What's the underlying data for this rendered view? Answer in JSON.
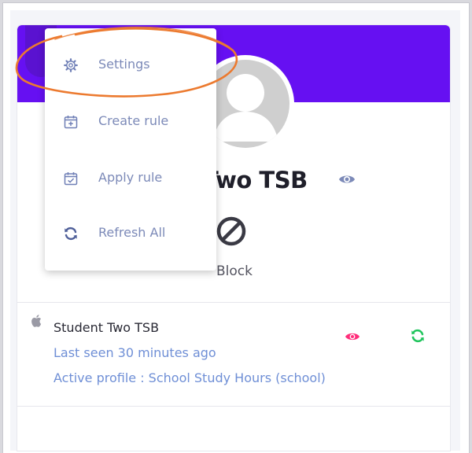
{
  "menu": {
    "items": [
      {
        "label": "Settings",
        "icon": "gear-icon"
      },
      {
        "label": "Create rule",
        "icon": "calendar-plus-icon"
      },
      {
        "label": "Apply rule",
        "icon": "calendar-check-icon"
      },
      {
        "label": "Refresh All",
        "icon": "refresh-icon"
      }
    ]
  },
  "student": {
    "name": "Two TSB",
    "block_label": "Block"
  },
  "device": {
    "platform_icon": "apple-icon",
    "name": "Student Two TSB",
    "last_seen": "Last seen 30 minutes ago",
    "active_profile": "Active profile : School Study Hours (school)"
  },
  "colors": {
    "header": "#6610f2",
    "menu_text": "#7c8ab8",
    "link_text": "#6f8fd6",
    "eye_pink": "#ff2d7a",
    "refresh_green": "#22c55e",
    "annotation": "#ec7a2f"
  }
}
